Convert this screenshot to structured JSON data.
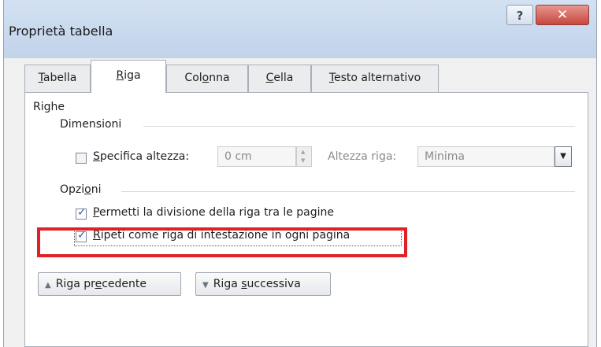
{
  "window": {
    "title": "Proprietà tabella",
    "help_label": "?",
    "close_label": "✕"
  },
  "tabs": [
    {
      "pre": "",
      "ul": "T",
      "post": "abella",
      "active": false
    },
    {
      "pre": "",
      "ul": "R",
      "post": "iga",
      "active": true
    },
    {
      "pre": "Col",
      "ul": "o",
      "post": "nna",
      "active": false
    },
    {
      "pre": "",
      "ul": "C",
      "post": "ella",
      "active": false
    },
    {
      "pre": "",
      "ul": "T",
      "post": "esto alternativo",
      "active": false
    }
  ],
  "panel": {
    "section_title": "Righe",
    "dimensions": {
      "heading": "Dimensioni",
      "specify_height": {
        "pre": "",
        "ul": "S",
        "post": "pecifica altezza:",
        "checked": false
      },
      "height_value": "0 cm",
      "row_height_label": "Altezza riga:",
      "row_height_select": "Minima"
    },
    "options": {
      "heading_pre": "Opzi",
      "heading_ul": "o",
      "heading_post": "ni",
      "allow_break": {
        "pre": "",
        "ul": "P",
        "post": "ermetti la divisione della riga tra le pagine",
        "checked": true
      },
      "repeat_header": {
        "pre": "",
        "ul": "R",
        "post": "ipeti come riga di intestazione in ogni pagina",
        "checked": true
      }
    },
    "prev_row_button": {
      "pre": "Riga pr",
      "ul": "e",
      "post": "cedente"
    },
    "next_row_button": {
      "pre": "Riga ",
      "ul": "s",
      "post": "uccessiva"
    }
  },
  "colors": {
    "highlight": "#e02228",
    "check": "#2c5fb4"
  },
  "icons": {
    "help": "help-icon",
    "close": "close-icon",
    "spin_up": "spin-up-icon",
    "spin_down": "spin-down-icon",
    "dropdown": "chevron-down-icon",
    "prev": "triangle-up-icon",
    "next": "triangle-down-icon"
  }
}
